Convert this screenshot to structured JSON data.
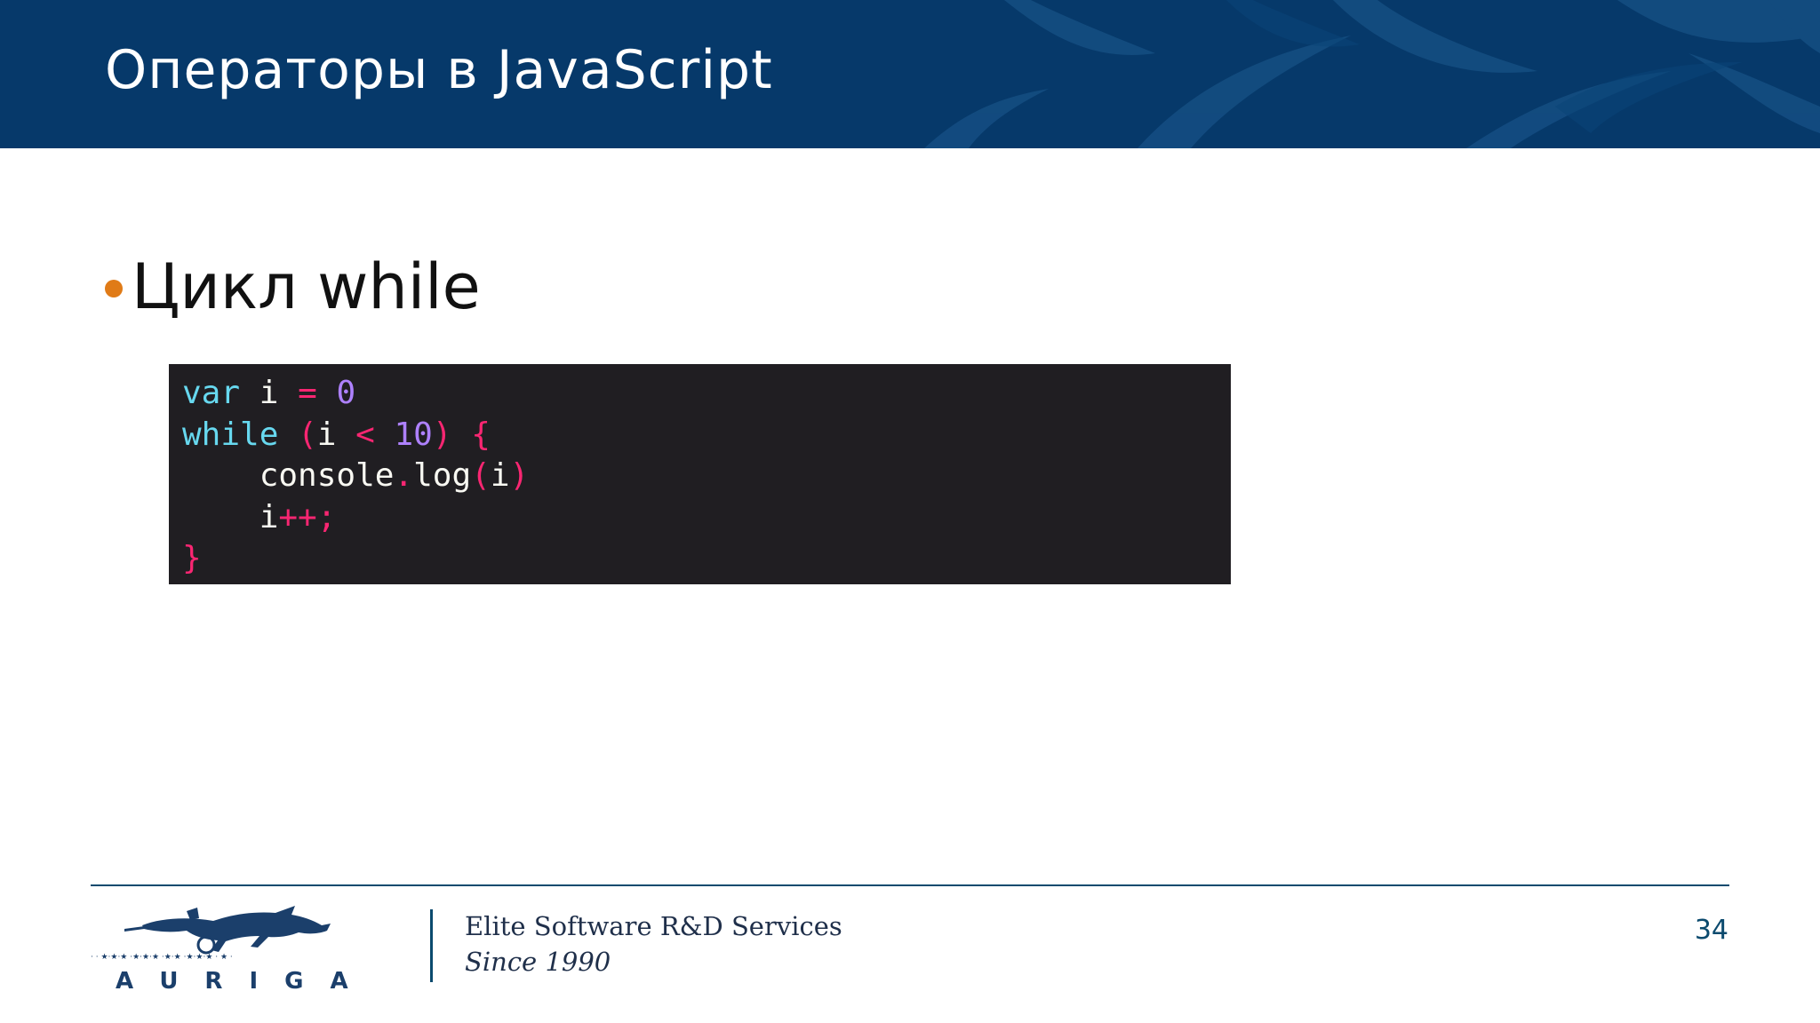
{
  "slide": {
    "title": "Операторы в JavaScript",
    "bullet": "Цикл while",
    "page_number": "34"
  },
  "code": {
    "language": "javascript",
    "lines": [
      [
        {
          "t": "var",
          "c": "kw"
        },
        {
          "t": " i ",
          "c": "pl"
        },
        {
          "t": "=",
          "c": "op"
        },
        {
          "t": " ",
          "c": "pl"
        },
        {
          "t": "0",
          "c": "num"
        }
      ],
      [
        {
          "t": "while",
          "c": "kw"
        },
        {
          "t": " ",
          "c": "pl"
        },
        {
          "t": "(",
          "c": "op"
        },
        {
          "t": "i ",
          "c": "pl"
        },
        {
          "t": "<",
          "c": "op"
        },
        {
          "t": " ",
          "c": "pl"
        },
        {
          "t": "10",
          "c": "num"
        },
        {
          "t": ")",
          "c": "op"
        },
        {
          "t": " ",
          "c": "pl"
        },
        {
          "t": "{",
          "c": "op"
        }
      ],
      [
        {
          "t": "    console",
          "c": "pl"
        },
        {
          "t": ".",
          "c": "op"
        },
        {
          "t": "log",
          "c": "pl"
        },
        {
          "t": "(",
          "c": "op"
        },
        {
          "t": "i",
          "c": "pl"
        },
        {
          "t": ")",
          "c": "op"
        }
      ],
      [
        {
          "t": "    i",
          "c": "pl"
        },
        {
          "t": "++;",
          "c": "op"
        }
      ],
      [
        {
          "t": "}",
          "c": "op"
        }
      ]
    ]
  },
  "footer": {
    "logo_text": "AURIGA",
    "tagline_1": "Elite Software R&D Services",
    "tagline_2": "Since 1990"
  },
  "colors": {
    "header_bg": "#06396a",
    "bullet": "#e07b17",
    "code_bg": "#201e22",
    "keyword": "#67d8ef",
    "operator": "#f92672",
    "number": "#ae81ff",
    "footer_rule": "#0b4a6e"
  }
}
